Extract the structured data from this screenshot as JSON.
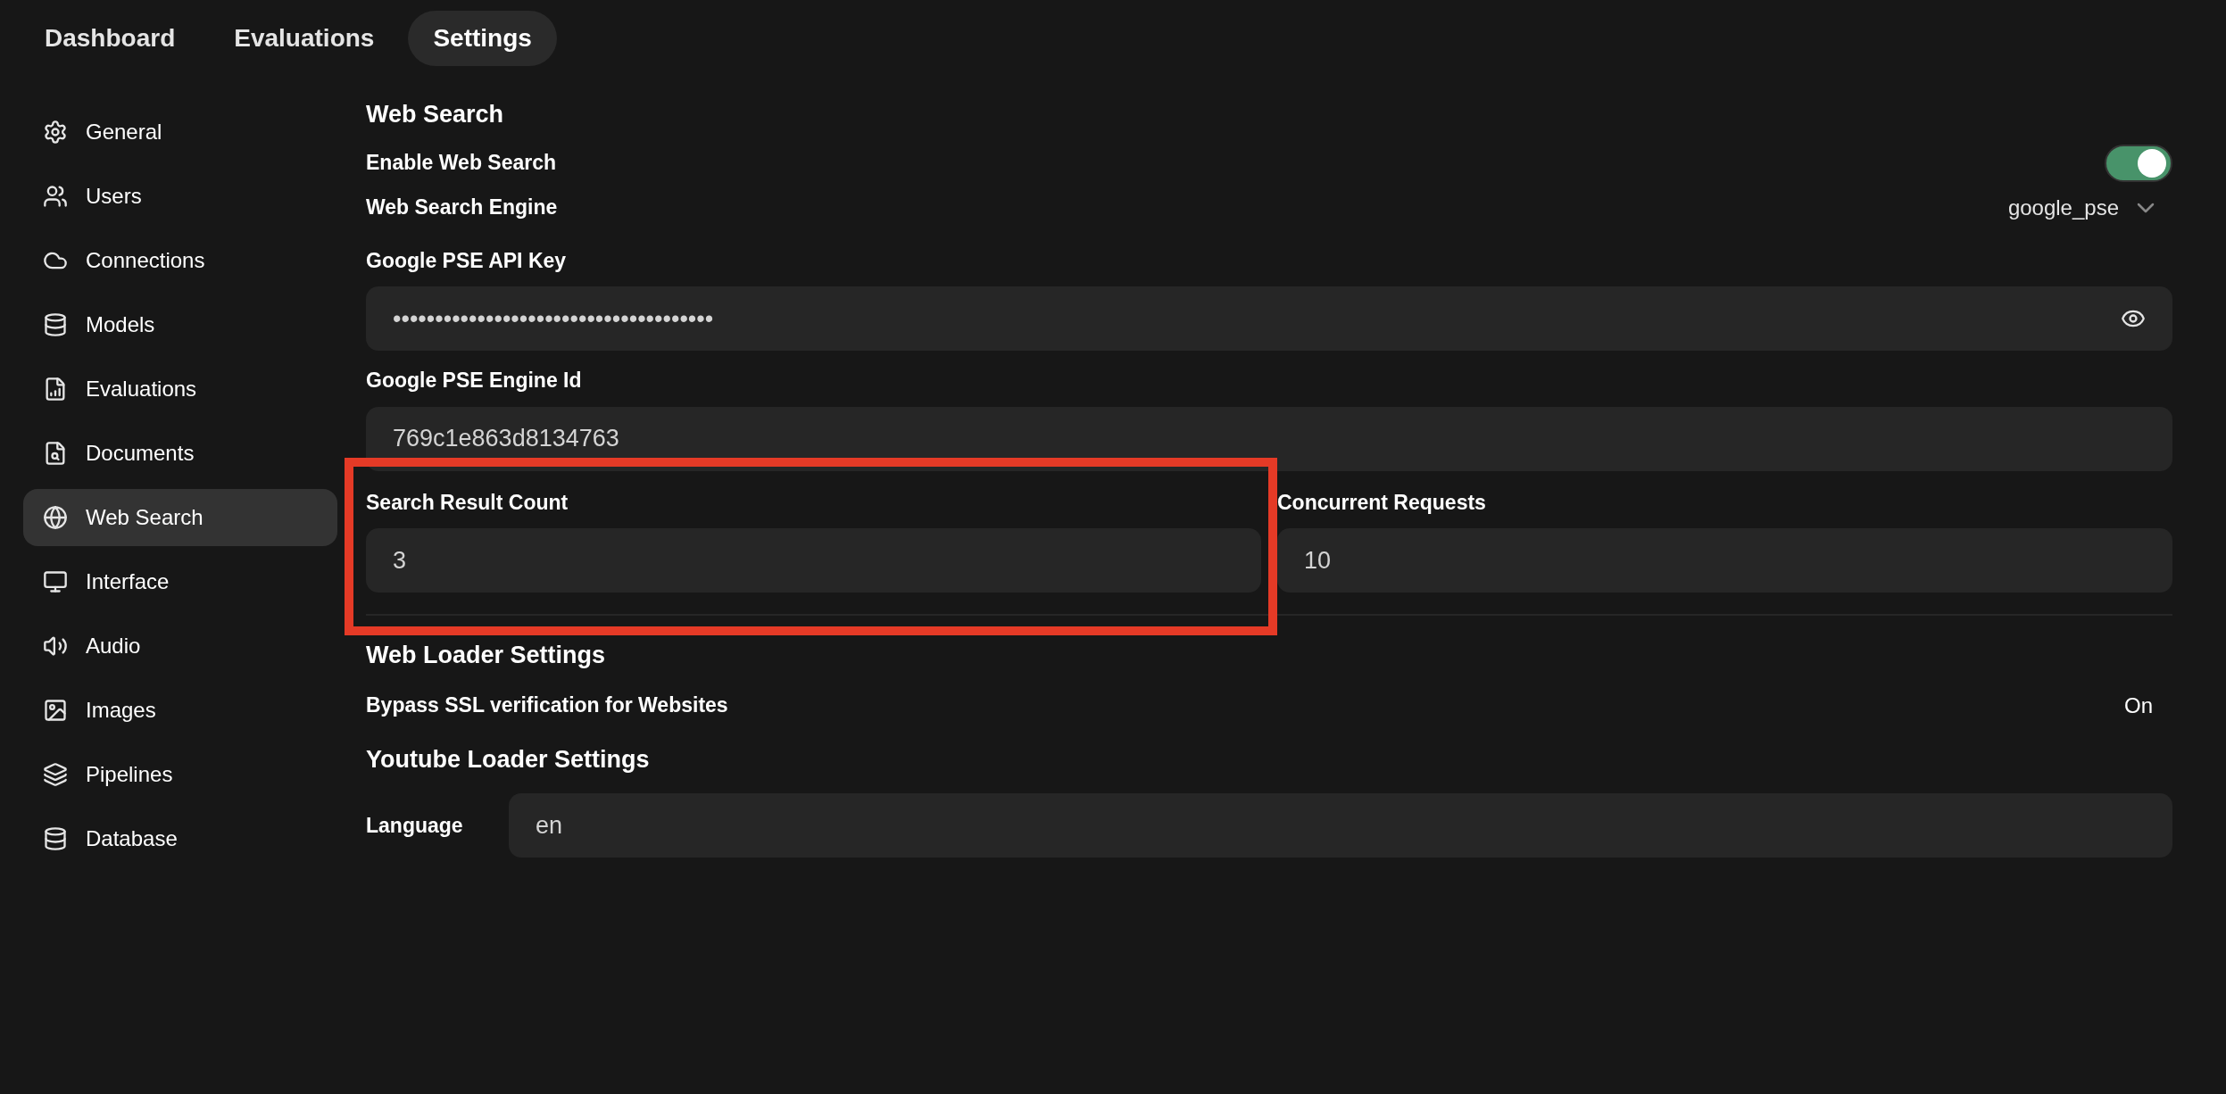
{
  "tabs": [
    {
      "label": "Dashboard",
      "selected": false
    },
    {
      "label": "Evaluations",
      "selected": false
    },
    {
      "label": "Settings",
      "selected": true
    }
  ],
  "sidebar": {
    "items": [
      {
        "label": "General",
        "selected": false
      },
      {
        "label": "Users",
        "selected": false
      },
      {
        "label": "Connections",
        "selected": false
      },
      {
        "label": "Models",
        "selected": false
      },
      {
        "label": "Evaluations",
        "selected": false
      },
      {
        "label": "Documents",
        "selected": false
      },
      {
        "label": "Web Search",
        "selected": true
      },
      {
        "label": "Interface",
        "selected": false
      },
      {
        "label": "Audio",
        "selected": false
      },
      {
        "label": "Images",
        "selected": false
      },
      {
        "label": "Pipelines",
        "selected": false
      },
      {
        "label": "Database",
        "selected": false
      }
    ]
  },
  "web_search": {
    "title": "Web Search",
    "enable": {
      "label": "Enable Web Search",
      "on": true
    },
    "engine": {
      "label": "Web Search Engine",
      "value": "google_pse"
    },
    "api_key": {
      "label": "Google PSE API Key",
      "value": "••••••••••••••••••••••••••••••••••••••"
    },
    "engine_id": {
      "label": "Google PSE Engine Id",
      "value": "769c1e863d8134763"
    },
    "result_count": {
      "label": "Search Result Count",
      "value": "3",
      "highlighted": true
    },
    "concurrent": {
      "label": "Concurrent Requests",
      "value": "10"
    }
  },
  "web_loader": {
    "title": "Web Loader Settings",
    "bypass_ssl": {
      "label": "Bypass SSL verification for Websites",
      "value": "On"
    }
  },
  "youtube_loader": {
    "title": "Youtube Loader Settings",
    "language": {
      "label": "Language",
      "value": "en"
    }
  }
}
